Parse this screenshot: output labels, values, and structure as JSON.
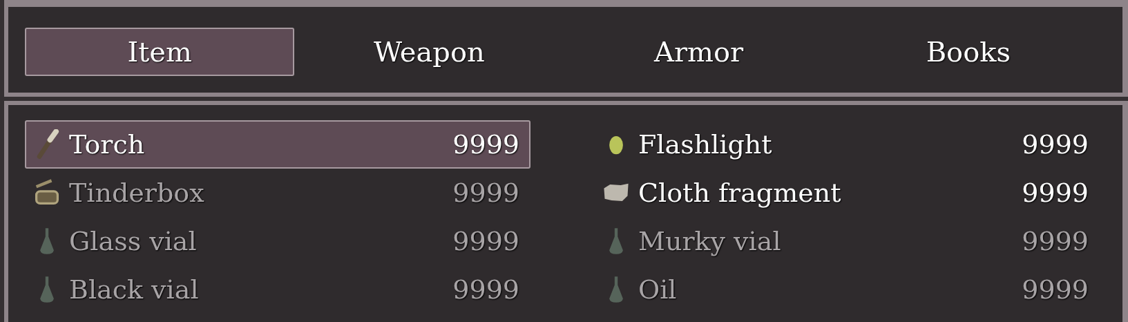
{
  "tabs": [
    {
      "label": "Item",
      "selected": true
    },
    {
      "label": "Weapon",
      "selected": false
    },
    {
      "label": "Armor",
      "selected": false
    },
    {
      "label": "Books",
      "selected": false
    }
  ],
  "items": [
    {
      "kind": "torch",
      "name": "Torch",
      "count": "9999",
      "selected": true,
      "disabled": false
    },
    {
      "kind": "stone",
      "name": "Flashlight",
      "count": "9999",
      "selected": false,
      "disabled": false
    },
    {
      "kind": "box",
      "name": "Tinderbox",
      "count": "9999",
      "selected": false,
      "disabled": true
    },
    {
      "kind": "cloth",
      "name": "Cloth fragment",
      "count": "9999",
      "selected": false,
      "disabled": false
    },
    {
      "kind": "vial",
      "name": "Glass vial",
      "count": "9999",
      "selected": false,
      "disabled": true
    },
    {
      "kind": "vial",
      "name": "Murky vial",
      "count": "9999",
      "selected": false,
      "disabled": true
    },
    {
      "kind": "vial",
      "name": "Black vial",
      "count": "9999",
      "selected": false,
      "disabled": true
    },
    {
      "kind": "vial",
      "name": "Oil",
      "count": "9999",
      "selected": false,
      "disabled": true
    }
  ]
}
